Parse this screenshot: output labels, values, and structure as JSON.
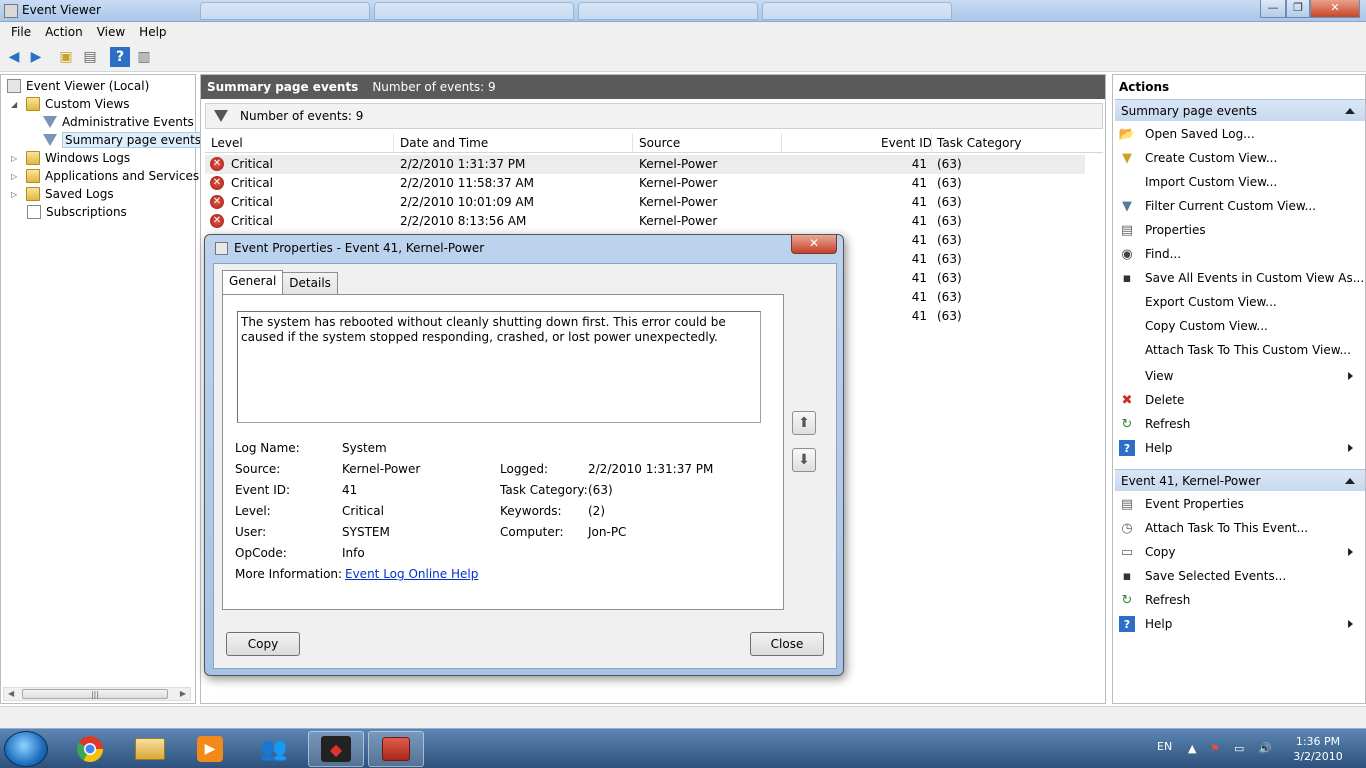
{
  "window": {
    "title": "Event Viewer"
  },
  "menubar": [
    "File",
    "Action",
    "View",
    "Help"
  ],
  "tree": {
    "root": "Event Viewer (Local)",
    "custom_views": "Custom Views",
    "administrative_events": "Administrative Events",
    "summary_page_events": "Summary page events",
    "windows_logs": "Windows Logs",
    "apps_services": "Applications and Services Lo",
    "saved_logs": "Saved Logs",
    "subscriptions": "Subscriptions"
  },
  "center": {
    "header_title": "Summary page events",
    "header_count": "Number of events: 9",
    "filter_text": "Number of events: 9",
    "columns": {
      "level": "Level",
      "date": "Date and Time",
      "source": "Source",
      "event_id": "Event ID",
      "task": "Task Category"
    },
    "rows": [
      {
        "level": "Critical",
        "date": "2/2/2010 1:31:37 PM",
        "source": "Kernel-Power",
        "event_id": "41",
        "task": "(63)"
      },
      {
        "level": "Critical",
        "date": "2/2/2010 11:58:37 AM",
        "source": "Kernel-Power",
        "event_id": "41",
        "task": "(63)"
      },
      {
        "level": "Critical",
        "date": "2/2/2010 10:01:09 AM",
        "source": "Kernel-Power",
        "event_id": "41",
        "task": "(63)"
      },
      {
        "level": "Critical",
        "date": "2/2/2010 8:13:56 AM",
        "source": "Kernel-Power",
        "event_id": "41",
        "task": "(63)"
      },
      {
        "level": "",
        "date": "",
        "source": "",
        "event_id": "41",
        "task": "(63)"
      },
      {
        "level": "",
        "date": "",
        "source": "",
        "event_id": "41",
        "task": "(63)"
      },
      {
        "level": "",
        "date": "",
        "source": "",
        "event_id": "41",
        "task": "(63)"
      },
      {
        "level": "",
        "date": "",
        "source": "",
        "event_id": "41",
        "task": "(63)"
      },
      {
        "level": "",
        "date": "",
        "source": "",
        "event_id": "41",
        "task": "(63)"
      }
    ]
  },
  "actions": {
    "title": "Actions",
    "section1": "Summary page events",
    "items1": [
      "Open Saved Log...",
      "Create Custom View...",
      "Import Custom View...",
      "Filter Current Custom View...",
      "Properties",
      "Find...",
      "Save All Events in Custom View As...",
      "Export Custom View...",
      "Copy Custom View...",
      "Attach Task To This Custom View...",
      "View",
      "Delete",
      "Refresh",
      "Help"
    ],
    "section2": "Event 41, Kernel-Power",
    "items2": [
      "Event Properties",
      "Attach Task To This Event...",
      "Copy",
      "Save Selected Events...",
      "Refresh",
      "Help"
    ]
  },
  "dialog": {
    "title": "Event Properties - Event 41, Kernel-Power",
    "close_glyph": "✕",
    "tabs": [
      "General",
      "Details"
    ],
    "description": "The system has rebooted without cleanly shutting down first. This error could be caused if the system stopped responding, crashed, or lost power unexpectedly.",
    "props": {
      "log_name_label": "Log Name:",
      "log_name": "System",
      "source_label": "Source:",
      "source": "Kernel-Power",
      "event_id_label": "Event ID:",
      "event_id": "41",
      "level_label": "Level:",
      "level": "Critical",
      "user_label": "User:",
      "user": "SYSTEM",
      "opcode_label": "OpCode:",
      "opcode": "Info",
      "more_info_label": "More Information:",
      "more_info_link": "Event Log Online Help",
      "logged_label": "Logged:",
      "logged": "2/2/2010 1:31:37 PM",
      "task_category_label": "Task Category:",
      "task_category": "(63)",
      "keywords_label": "Keywords:",
      "keywords": "(2)",
      "computer_label": "Computer:",
      "computer": "Jon-PC"
    },
    "copy_button": "Copy",
    "close_button": "Close"
  },
  "taskbar": {
    "lang": "EN",
    "time": "1:36 PM",
    "date": "3/2/2010"
  },
  "colors": {
    "accent": "#3e6fb0",
    "critical": "#c0281a",
    "link": "#0033cc"
  }
}
